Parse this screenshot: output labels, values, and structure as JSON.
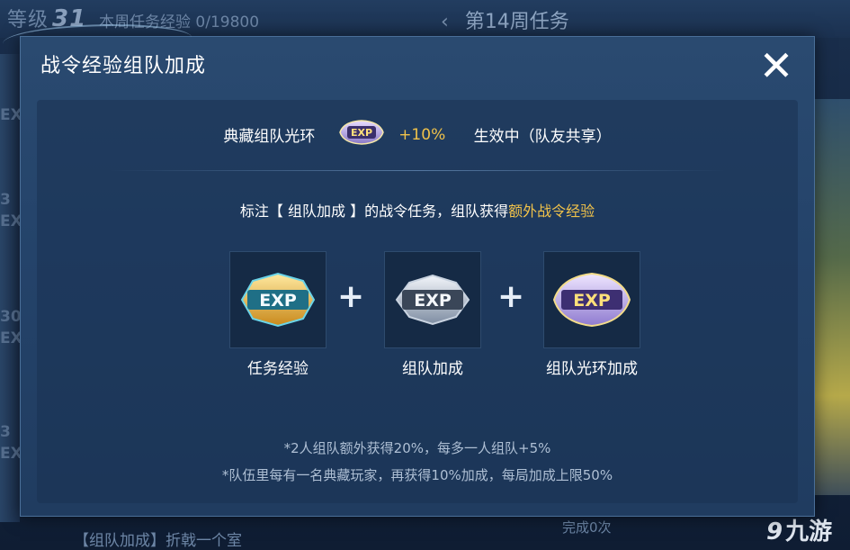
{
  "background": {
    "level_label": "等级",
    "level_value": "31",
    "weekly_exp": "本周任务经验 0/19800",
    "week_title": "第14周任务",
    "left_numbers": [
      "EX",
      "3",
      "EX",
      "30",
      "EX",
      "3",
      "EX"
    ],
    "bottom_text": "【组队加成】折戟一个室",
    "done_text": "完成0次"
  },
  "watermark": {
    "text": "九游",
    "glyph": "9"
  },
  "dialog": {
    "title": "战令经验组队加成",
    "close_icon": "✕",
    "aura": {
      "label": "典藏组队光环",
      "badge_text": "EXP",
      "bonus": "+10%",
      "status": "生效中（队友共享）"
    },
    "note": {
      "prefix": "标注【 组队加成 】的战令任务，组队获得",
      "highlight": "额外战令经验"
    },
    "items": [
      {
        "badge_text": "EXP",
        "label": "任务经验",
        "style": "gold"
      },
      {
        "badge_text": "EXP",
        "label": "组队加成",
        "style": "silver"
      },
      {
        "badge_text": "EXP",
        "label": "组队光环加成",
        "style": "aura"
      }
    ],
    "plus": "+",
    "footnotes": [
      "*2人组队额外获得20%，每多一人组队+5%",
      "*队伍里每有一名典藏玩家，再获得10%加成，每局加成上限50%"
    ]
  },
  "colors": {
    "highlight": "#f0c24a",
    "dialog_bg": "#24436a",
    "text": "#ffffff",
    "footnote": "#aebfd4"
  }
}
